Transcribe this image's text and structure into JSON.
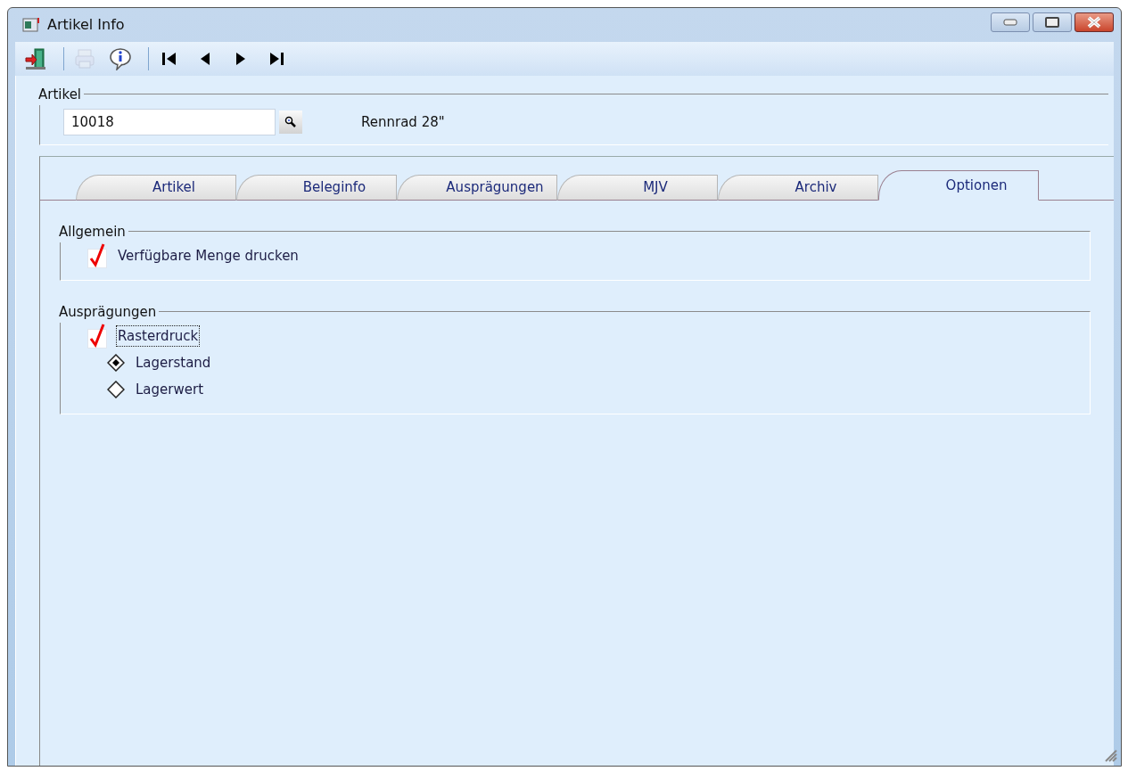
{
  "window": {
    "title": "Artikel Info"
  },
  "toolbar": [
    {
      "kind": "exit",
      "disabled": false
    },
    {
      "kind": "separator"
    },
    {
      "kind": "print",
      "disabled": true
    },
    {
      "kind": "info",
      "disabled": false
    },
    {
      "kind": "separator"
    },
    {
      "kind": "first",
      "disabled": false
    },
    {
      "kind": "prev",
      "disabled": false
    },
    {
      "kind": "next",
      "disabled": false
    },
    {
      "kind": "last",
      "disabled": false
    }
  ],
  "artikel": {
    "legend": "Artikel",
    "number": "10018",
    "description": "Rennrad 28\""
  },
  "tabs": [
    {
      "label": "Artikel",
      "selected": false
    },
    {
      "label": "Beleginfo",
      "selected": false
    },
    {
      "label": "Ausprägungen",
      "selected": false
    },
    {
      "label": "MJV",
      "selected": false
    },
    {
      "label": "Archiv",
      "selected": false
    },
    {
      "label": "Optionen",
      "selected": true
    }
  ],
  "sections": [
    {
      "legend": "Allgemein",
      "options": [
        {
          "kind": "checkbox",
          "label": "Verfügbare Menge drucken",
          "checked": true,
          "focused": false
        }
      ]
    },
    {
      "legend": "Ausprägungen",
      "options": [
        {
          "kind": "checkbox",
          "label": "Rasterdruck",
          "checked": true,
          "focused": true
        },
        {
          "kind": "radio",
          "label": "Lagerstand",
          "selected": true
        },
        {
          "kind": "radio",
          "label": "Lagerwert",
          "selected": false
        }
      ]
    }
  ]
}
